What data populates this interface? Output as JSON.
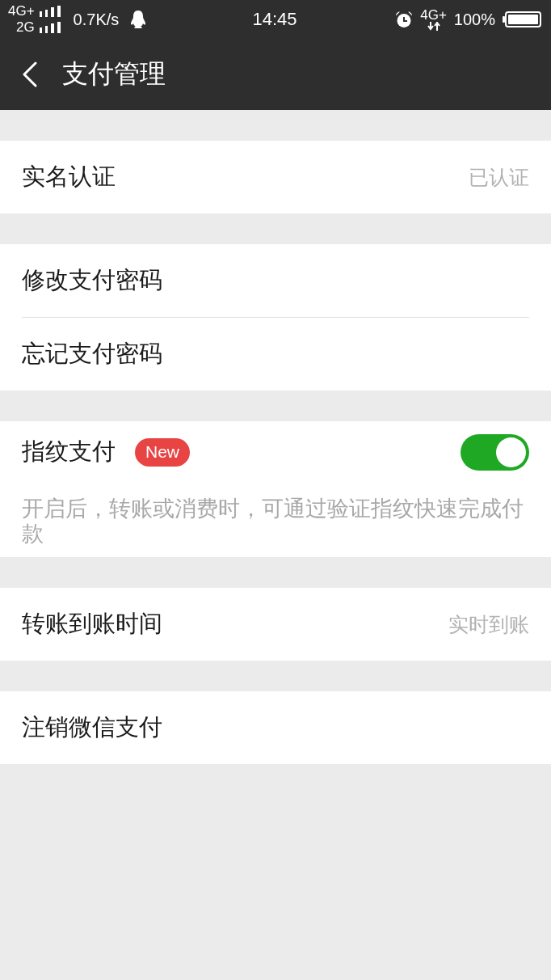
{
  "status_bar": {
    "network_top": "4G+",
    "network_bottom": "2G",
    "speed": "0.7K/s",
    "time": "14:45",
    "data_network": "4G+",
    "battery": "100%"
  },
  "nav_bar": {
    "title": "支付管理"
  },
  "groups": [
    {
      "items": [
        {
          "kind": "value",
          "label": "实名认证",
          "value": "已认证"
        }
      ]
    },
    {
      "items": [
        {
          "kind": "plain",
          "label": "修改支付密码"
        },
        {
          "kind": "plain",
          "label": "忘记支付密码"
        }
      ]
    },
    {
      "items": [
        {
          "kind": "toggle",
          "label": "指纹支付",
          "badge": "New",
          "on": true,
          "description": "开启后，转账或消费时，可通过验证指纹快速完成付款"
        }
      ]
    },
    {
      "items": [
        {
          "kind": "value",
          "label": "转账到账时间",
          "value": "实时到账"
        }
      ]
    },
    {
      "items": [
        {
          "kind": "plain",
          "label": "注销微信支付"
        }
      ]
    }
  ]
}
